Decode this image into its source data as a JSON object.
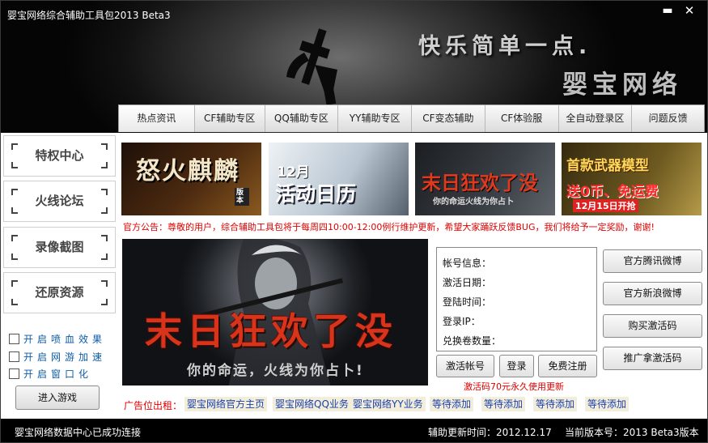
{
  "window": {
    "title": "婴宝网络综合辅助工具包2013 Beta3",
    "minimize_glyph": "▬",
    "close_glyph": "✕"
  },
  "banner": {
    "slogan_line1": "快乐简单一点.",
    "slogan_line2": "婴宝网络"
  },
  "nav": {
    "tabs": [
      {
        "label": "热点资讯",
        "active": true
      },
      {
        "label": "CF辅助专区"
      },
      {
        "label": "QQ辅助专区"
      },
      {
        "label": "YY辅助专区"
      },
      {
        "label": "CF变态辅助"
      },
      {
        "label": "CF体验服"
      },
      {
        "label": "全自动登录区"
      },
      {
        "label": "问题反馈"
      }
    ]
  },
  "sidebar": {
    "buttons": [
      "特权中心",
      "火线论坛",
      "录像截图",
      "还原资源"
    ],
    "checkboxes": [
      "开启喷血效果",
      "开启网游加速",
      "开启窗口化"
    ],
    "enter_game": "进入游戏"
  },
  "thumbs": {
    "t1": {
      "line1": "怒火麒麟",
      "tag": "版本"
    },
    "t2": {
      "line1": "12月",
      "line2": "活动日历"
    },
    "t3": {
      "line1": "末日狂欢了没",
      "line2": "你的命运火线为你占卜"
    },
    "t4": {
      "line1": "首款武器模型",
      "line2": "送0币、免运费",
      "line3": "12月15日开抢"
    }
  },
  "notice": "官方公告：尊敬的用户，综合辅助工具包将于每周四10:00-12:00例行维护更新，希望大家踊跃反馈BUG，我们将给予一定奖励，谢谢!",
  "promo": {
    "title": "末日狂欢了没",
    "subtitle": "你的命运，火线为你占卜!"
  },
  "account": {
    "fields": [
      "帐号信息：",
      "激活日期：",
      "登陆时间：",
      "登录IP：",
      "兑换卷数量："
    ],
    "activate_button": "激活帐号",
    "login_button": "登录",
    "register_button": "免费注册",
    "note": "激活码70元永久使用更新"
  },
  "right_buttons": [
    "官方腾讯微博",
    "官方新浪微博",
    "购买激活码",
    "推广拿激活码"
  ],
  "ads": {
    "label": "广告位出租：",
    "links": [
      "婴宝网络官方主页",
      "婴宝网络QQ业务",
      "婴宝网络YY业务",
      "等待添加",
      "等待添加",
      "等待添加",
      "等待添加"
    ]
  },
  "status": {
    "connection": "婴宝网络数据中心已成功连接",
    "update_time": "辅助更新时间：2012.12.17",
    "version": "当前版本号：2013 Beta3版本"
  },
  "colors": {
    "notice_red": "#e00000",
    "link_blue": "#1a3fb0",
    "checkbox_blue": "#0c5ca8",
    "status_bg": "#000000"
  }
}
